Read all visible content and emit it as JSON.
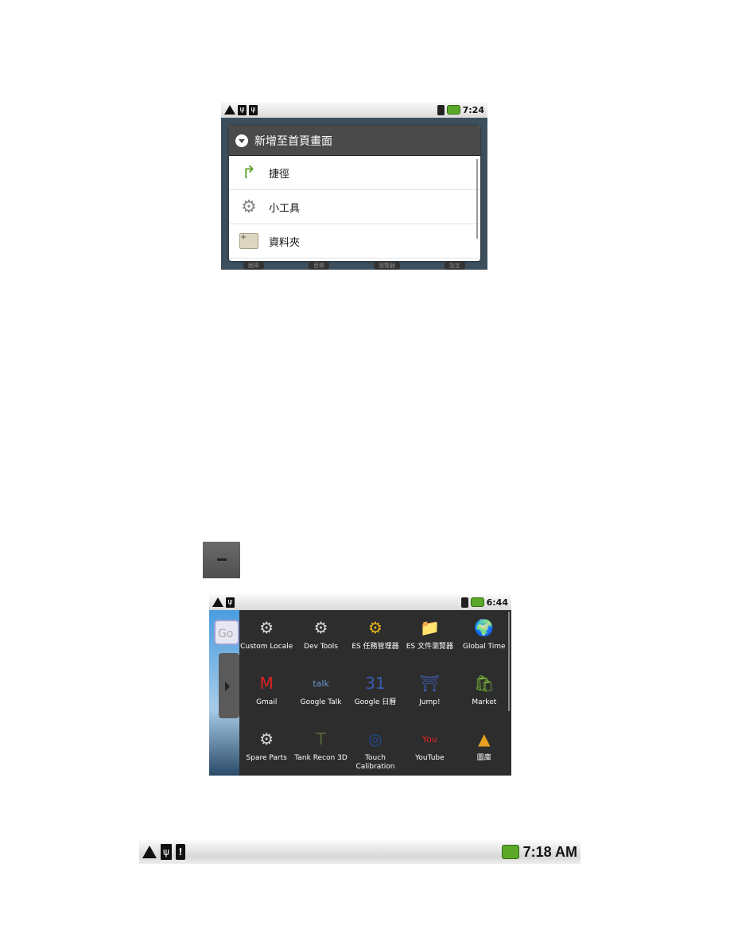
{
  "screenshot1": {
    "status_bar": {
      "time": "7:24",
      "icons": [
        "warning-icon",
        "usb-icon",
        "usb-icon",
        "wifi-icon",
        "battery-icon"
      ]
    },
    "dialog": {
      "title": "新增至首頁畫面",
      "items": [
        {
          "label": "捷徑",
          "icon": "shortcut-arrow-icon"
        },
        {
          "label": "小工具",
          "icon": "gear-icon"
        },
        {
          "label": "資料夾",
          "icon": "folder-icon"
        }
      ]
    },
    "background_tabs": [
      "圖庫",
      "音樂",
      "瀏覽器",
      "設定"
    ]
  },
  "screenshot2": {
    "status_bar": {
      "time": "6:44",
      "icons": [
        "warning-icon",
        "usb-icon",
        "wifi-icon",
        "battery-icon"
      ]
    },
    "apps": [
      {
        "label": "Custom Locale",
        "icon": "gear-icon",
        "glyph": "⚙",
        "color": "#d8d8d8"
      },
      {
        "label": "Dev Tools",
        "icon": "gear-icon",
        "glyph": "⚙",
        "color": "#d8d8d8"
      },
      {
        "label": "ES 任務管理器",
        "icon": "task-manager-icon",
        "glyph": "⚙",
        "color": "#e0b21a"
      },
      {
        "label": "ES 文件瀏覽器",
        "icon": "file-browser-icon",
        "glyph": "📁",
        "color": "#e0a040"
      },
      {
        "label": "Global Time",
        "icon": "globe-clock-icon",
        "glyph": "🌍",
        "color": "#3a9a3a"
      },
      {
        "label": "Gmail",
        "icon": "gmail-icon",
        "glyph": "M",
        "color": "#d22"
      },
      {
        "label": "Google Talk",
        "icon": "talk-icon",
        "glyph": "talk",
        "color": "#6a9ad0"
      },
      {
        "label": "Google 日曆",
        "icon": "calendar-icon",
        "glyph": "31",
        "color": "#3a5ab0"
      },
      {
        "label": "Jump!",
        "icon": "jump-game-icon",
        "glyph": "⛩",
        "color": "#3b5aa8"
      },
      {
        "label": "Market",
        "icon": "market-icon",
        "glyph": "🛍",
        "color": "#7ab83a"
      },
      {
        "label": "Spare Parts",
        "icon": "gear-icon",
        "glyph": "⚙",
        "color": "#d8d8d8"
      },
      {
        "label": "Tank Recon 3D",
        "icon": "tank-icon",
        "glyph": "T",
        "color": "#55663a"
      },
      {
        "label": "Touch Calibration",
        "icon": "target-icon",
        "glyph": "◎",
        "color": "#1d4f9a"
      },
      {
        "label": "YouTube",
        "icon": "youtube-icon",
        "glyph": "You",
        "color": "#d22"
      },
      {
        "label": "圖庫",
        "icon": "gallery-icon",
        "glyph": "▲",
        "color": "#e8a020"
      }
    ],
    "home_search_hint": "Go"
  },
  "screenshot3": {
    "status_bar": {
      "time": "7:18 AM",
      "icons": [
        "warning-icon",
        "usb-icon",
        "sd-card-warning-icon",
        "battery-icon"
      ]
    }
  }
}
